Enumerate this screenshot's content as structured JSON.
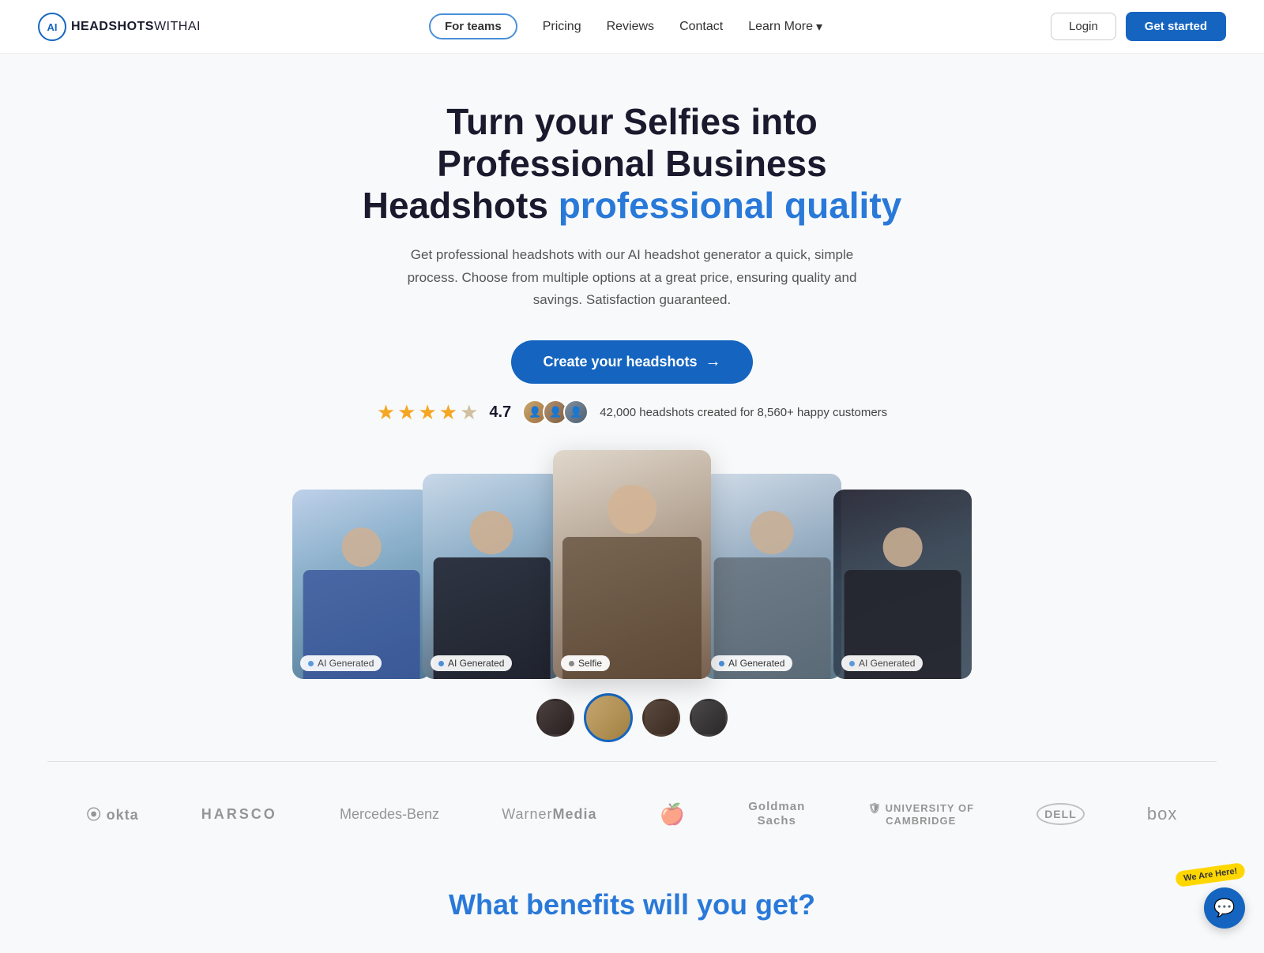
{
  "nav": {
    "logo_headshots": "HEADSHOTS",
    "logo_withai": "WITHAI",
    "links": [
      {
        "id": "for-teams",
        "label": "For teams",
        "outlined": true
      },
      {
        "id": "pricing",
        "label": "Pricing"
      },
      {
        "id": "reviews",
        "label": "Reviews"
      },
      {
        "id": "contact",
        "label": "Contact"
      },
      {
        "id": "learn-more",
        "label": "Learn More",
        "hasArrow": true
      }
    ],
    "login_label": "Login",
    "getstarted_label": "Get started"
  },
  "hero": {
    "title_line1": "Turn your Selfies into Professional Business",
    "title_line2": "Headshots ",
    "title_line2_blue": "professional quality",
    "subtitle": "Get professional headshots with our AI headshot generator a quick, simple process. Choose from multiple options at a great price, ensuring quality and savings. Satisfaction guaranteed.",
    "cta_label": "Create your headshots",
    "rating": "4.7",
    "rating_text": "42,000 headshots created for 8,560+ happy customers"
  },
  "gallery": {
    "photos": [
      {
        "id": "p1",
        "type": "ai",
        "label": "AI Generated",
        "colorClass": "p1"
      },
      {
        "id": "p2",
        "type": "ai",
        "label": "AI Generated",
        "colorClass": "p2"
      },
      {
        "id": "p3",
        "type": "selfie",
        "label": "Selfie",
        "colorClass": "p3-selfie"
      },
      {
        "id": "p4",
        "type": "ai",
        "label": "AI Generated",
        "colorClass": "p4"
      },
      {
        "id": "p5",
        "type": "ai",
        "label": "AI Generated",
        "colorClass": "p5"
      }
    ]
  },
  "brands": [
    {
      "id": "okta",
      "label": "⦿ okta"
    },
    {
      "id": "harsco",
      "label": "HARSCO"
    },
    {
      "id": "mercedes",
      "label": "Mercedes-Benz"
    },
    {
      "id": "warnermedia",
      "label": "WarnerMedia"
    },
    {
      "id": "apple",
      "label": "🍎"
    },
    {
      "id": "goldman",
      "label": "Goldman Sachs"
    },
    {
      "id": "cambridge",
      "label": "🛡 UNIVERSITY OF CAMBRIDGE"
    },
    {
      "id": "dell",
      "label": "⊙ DELL"
    },
    {
      "id": "box",
      "label": "box"
    }
  ],
  "bottom": {
    "heading": "What benefits will you get?"
  },
  "chat": {
    "label": "We Are Here!",
    "icon": "💬"
  }
}
